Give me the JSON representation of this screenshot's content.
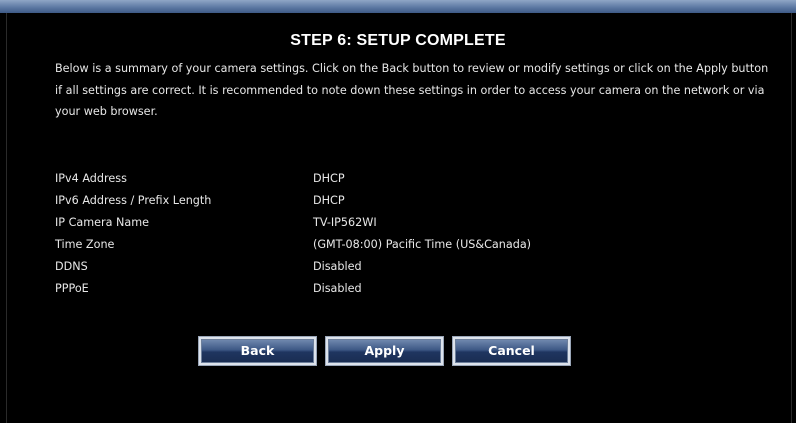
{
  "page": {
    "title": "STEP 6: SETUP COMPLETE",
    "intro": "Below is a summary of your camera settings. Click on the Back button to review or modify settings or click on the Apply button if all settings are correct. It is recommended to note down these settings in order to access your camera on the network or via your web browser."
  },
  "settings": [
    {
      "label": "IPv4 Address",
      "value": "DHCP"
    },
    {
      "label": "IPv6 Address / Prefix Length",
      "value": "DHCP"
    },
    {
      "label": "IP Camera Name",
      "value": "TV-IP562WI"
    },
    {
      "label": "Time Zone",
      "value": "(GMT-08:00) Pacific Time (US&Canada)"
    },
    {
      "label": "DDNS",
      "value": "Disabled"
    },
    {
      "label": "PPPoE",
      "value": "Disabled"
    }
  ],
  "buttons": {
    "back": "Back",
    "apply": "Apply",
    "cancel": "Cancel"
  },
  "colors": {
    "background": "#000000",
    "text": "#e8e8e8",
    "button_bg": "#2a4370",
    "top_bar": "#5e7aa4"
  }
}
